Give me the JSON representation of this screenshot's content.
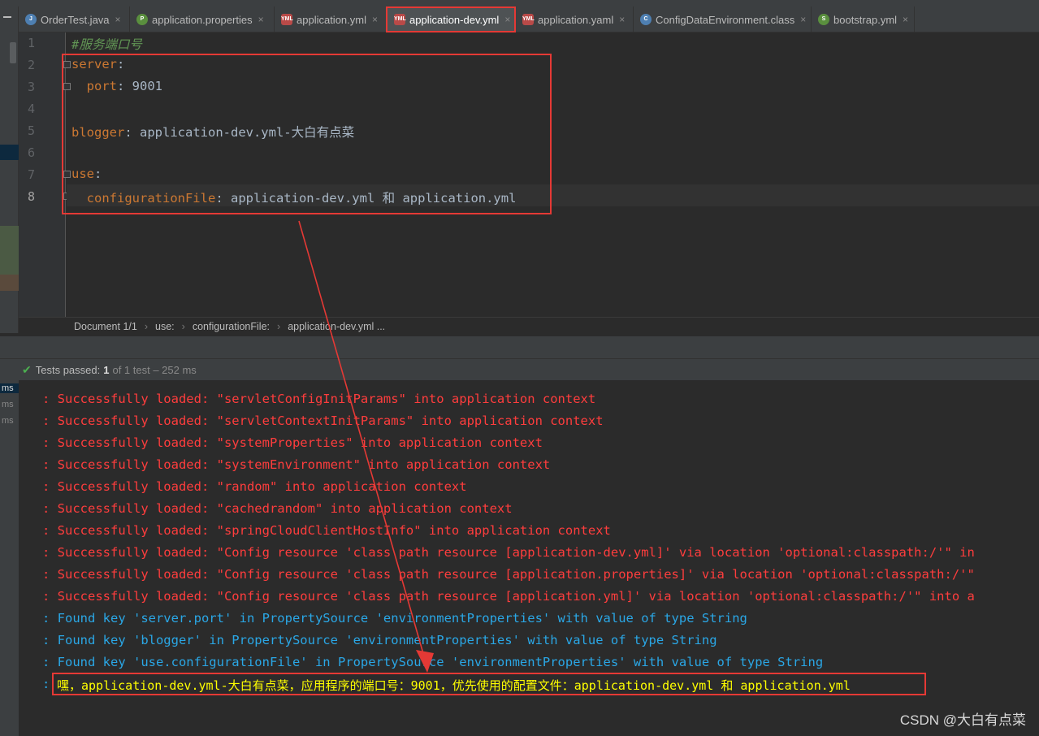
{
  "tabs": [
    {
      "label": "OrderTest.java",
      "icon": "java-class-icon",
      "active": false
    },
    {
      "label": "application.properties",
      "icon": "properties-file-icon",
      "active": false
    },
    {
      "label": "application.yml",
      "icon": "yml-file-icon",
      "active": false
    },
    {
      "label": "application-dev.yml",
      "icon": "yml-file-icon",
      "active": true
    },
    {
      "label": "application.yaml",
      "icon": "yml-file-icon",
      "active": false
    },
    {
      "label": "ConfigDataEnvironment.class",
      "icon": "class-file-icon",
      "active": false
    },
    {
      "label": "bootstrap.yml",
      "icon": "spring-yml-icon",
      "active": false
    }
  ],
  "editor": {
    "line_numbers": [
      "1",
      "2",
      "3",
      "4",
      "5",
      "6",
      "7",
      "8"
    ],
    "current_line": "8",
    "lines": [
      {
        "key": "",
        "sep": "",
        "value": "",
        "comment": "#服务端口号"
      },
      {
        "key": "server",
        "sep": ":",
        "value": "",
        "comment": ""
      },
      {
        "key": "  port",
        "sep": ":",
        "value": " 9001",
        "comment": ""
      },
      {
        "key": "",
        "sep": "",
        "value": "",
        "comment": ""
      },
      {
        "key": "blogger",
        "sep": ":",
        "value": " application-dev.yml-大白有点菜",
        "comment": ""
      },
      {
        "key": "",
        "sep": "",
        "value": "",
        "comment": ""
      },
      {
        "key": "use",
        "sep": ":",
        "value": "",
        "comment": ""
      },
      {
        "key": "  configurationFile",
        "sep": ":",
        "value": " application-dev.yml 和 application.yml",
        "comment": ""
      }
    ]
  },
  "breadcrumbs": {
    "document": "Document 1/1",
    "items": [
      "use:",
      "configurationFile:",
      "application-dev.yml ..."
    ]
  },
  "test_status": {
    "label": "Tests passed:",
    "count": "1",
    "detail": "of 1 test – 252 ms"
  },
  "ms_labels": [
    "ms",
    "ms",
    "ms"
  ],
  "console": {
    "lines": [
      {
        "text": ": Successfully loaded: \"servletConfigInitParams\" into application context",
        "color": "red"
      },
      {
        "text": ": Successfully loaded: \"servletContextInitParams\" into application context",
        "color": "red"
      },
      {
        "text": ": Successfully loaded: \"systemProperties\" into application context",
        "color": "red"
      },
      {
        "text": ": Successfully loaded: \"systemEnvironment\" into application context",
        "color": "red"
      },
      {
        "text": ": Successfully loaded: \"random\" into application context",
        "color": "red"
      },
      {
        "text": ": Successfully loaded: \"cachedrandom\" into application context",
        "color": "red"
      },
      {
        "text": ": Successfully loaded: \"springCloudClientHostInfo\" into application context",
        "color": "red"
      },
      {
        "text": ": Successfully loaded: \"Config resource 'class path resource [application-dev.yml]' via location 'optional:classpath:/'\" in",
        "color": "red"
      },
      {
        "text": ": Successfully loaded: \"Config resource 'class path resource [application.properties]' via location 'optional:classpath:/'\"",
        "color": "red"
      },
      {
        "text": ": Successfully loaded: \"Config resource 'class path resource [application.yml]' via location 'optional:classpath:/'\" into a",
        "color": "red"
      },
      {
        "text": ": Found key 'server.port' in PropertySource 'environmentProperties' with value of type String",
        "color": "cyan"
      },
      {
        "text": ": Found key 'blogger' in PropertySource 'environmentProperties' with value of type String",
        "color": "cyan"
      },
      {
        "text": ": Found key 'use.configurationFile' in PropertySource 'environmentProperties' with value of type String",
        "color": "cyan"
      }
    ],
    "final_prefix": ":",
    "final_text": "嘿，application-dev.yml-大白有点菜，应用程序的端口号：9001，优先使用的配置文件：application-dev.yml 和 application.yml"
  },
  "watermark": "CSDN @大白有点菜",
  "colors": {
    "highlight_box": "#e53935",
    "log_red": "#ff3d3d",
    "log_cyan": "#2aa7e6",
    "log_yellow": "#ffff00"
  }
}
